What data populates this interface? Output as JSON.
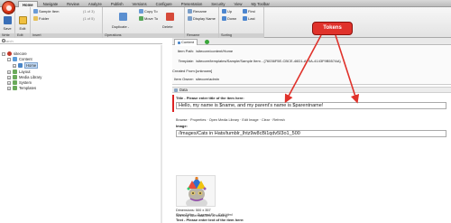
{
  "ribbon_tabs": [
    "Home",
    "Navigate",
    "Review",
    "Analyze",
    "Publish",
    "Versions",
    "Configure",
    "Presentation",
    "Security",
    "View",
    "My Toolbar"
  ],
  "ribbon": {
    "groups": {
      "write": "Write",
      "edit": "Edit",
      "insert": "Insert",
      "operations": "Operations",
      "rename": "Rename",
      "sorting": "Sorting"
    },
    "buttons": {
      "save": "Save",
      "edit": "Edit",
      "sample_item": "Sample Item",
      "folder": "Folder",
      "page_counter": "(1 of 3)",
      "page_counter2": "(1 of 5)",
      "duplicate": "Duplicate -",
      "copy_to": "Copy To",
      "move_to": "Move To",
      "delete": "Delete",
      "rename": "Rename",
      "display_name": "Display Name",
      "up": "Up",
      "first": "First",
      "down": "Down",
      "last": "Last"
    }
  },
  "search": {
    "placeholder": "Search"
  },
  "tree": {
    "root": "sitecore",
    "content": "Content",
    "home": "Home",
    "layout": "Layout",
    "media_library": "Media Library",
    "system": "System",
    "templates": "Templates"
  },
  "editor": {
    "tab_label": "Content",
    "info": {
      "item_path_label": "Item Path:",
      "item_path": "/sitecore/content/Home",
      "template_label": "Template:",
      "template": "/sitecore/templates/Sample/Sample Item - {76036F5E-CBCE-46D1-AF0A-4143F9B557AA}",
      "created_from_label": "Created From:",
      "created_from": "[unknown]",
      "item_owner_label": "Item Owner:",
      "item_owner": "sitecore\\admin"
    },
    "section_data": "Data",
    "title_label": "Title - Please enter title of the item here:",
    "title_value": "Hello, my name is $name, and my parent's name is $parentname!",
    "image_links": "Browse · Properties · Open Media Library · Edit Image · Clear · Refresh",
    "image_label": "Image:",
    "image_path": "/Images/Cats in Hats/tumblr_lhtz9w8cBi1qdv5l3o1_500",
    "dimensions": "Dimensions: 500 x 357",
    "warning": "Warning: Alternate Text is missing.",
    "text_links": "Show Editor · Suggest Fix · Edit Html",
    "text_label": "Text - Please enter text of the item here:"
  },
  "callout": {
    "label": "Tokens",
    "color": "#e0322b"
  }
}
